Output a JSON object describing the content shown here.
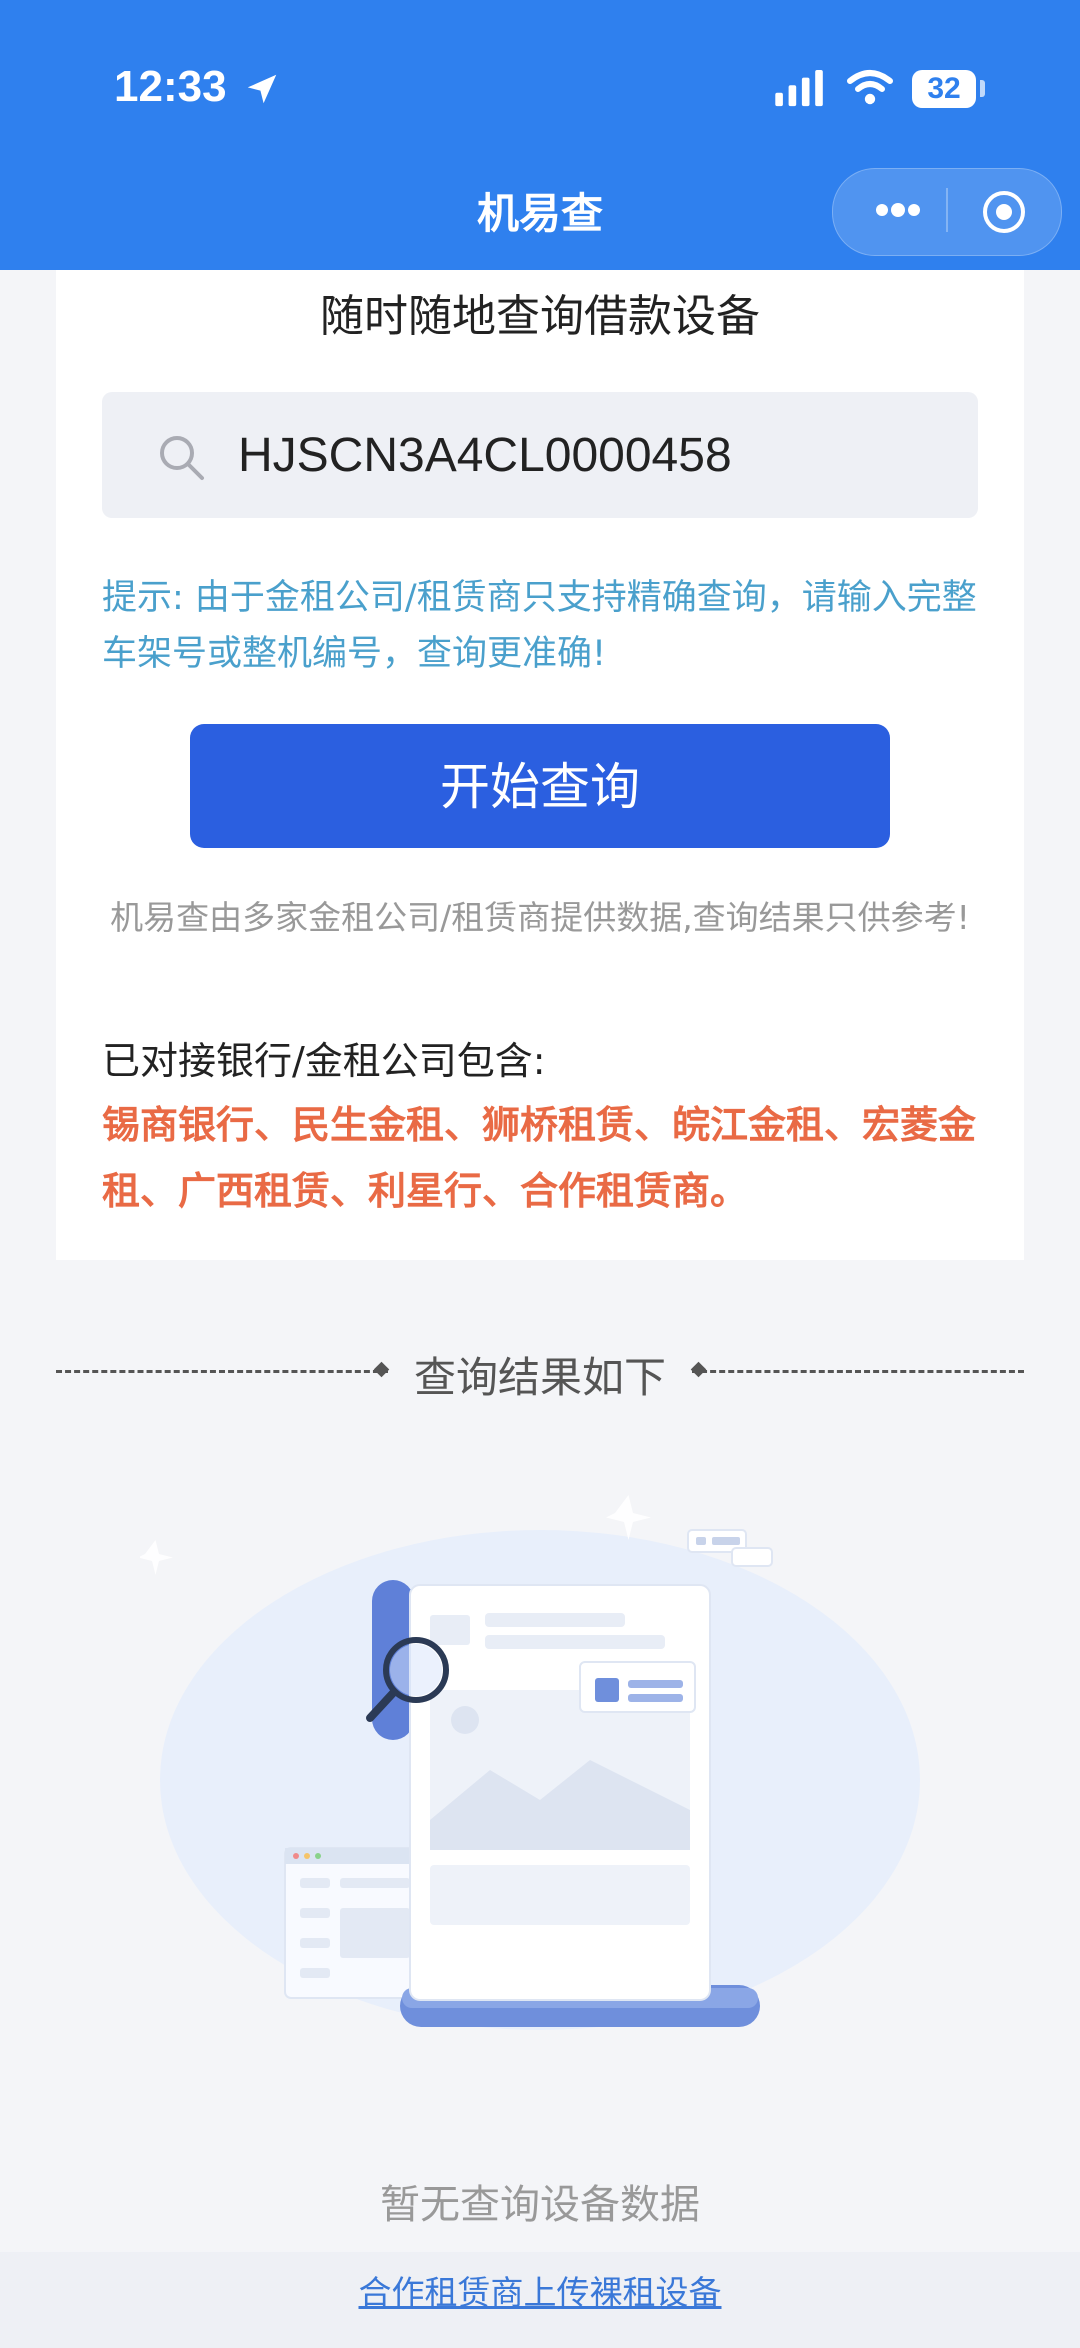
{
  "status_bar": {
    "time": "12:33",
    "battery": "32"
  },
  "nav": {
    "title": "机易查"
  },
  "card": {
    "title": "随时随地查询借款设备",
    "search": {
      "value": "HJSCN3A4CL0000458",
      "placeholder": ""
    },
    "tip": "提示: 由于金租公司/租赁商只支持精确查询，请输入完整车架号或整机编号，查询更准确!",
    "start_button": "开始查询",
    "disclaimer": "机易查由多家金租公司/租赁商提供数据,查询结果只供参考!",
    "partner_label": "已对接银行/金租公司包含:",
    "partners": "锡商银行、民生金租、狮桥租赁、皖江金租、宏菱金租、广西租赁、利星行、合作租赁商。"
  },
  "results": {
    "title": "查询结果如下",
    "empty_text": "暂无查询设备数据"
  },
  "footer": {
    "link": "合作租赁商上传裸租设备"
  },
  "colors": {
    "header": "#2f80ee",
    "primary_button": "#2b5fe0",
    "tip": "#4aa0cc",
    "partners": "#e96a45",
    "link": "#3a78d8"
  },
  "icons": {
    "location": "location-arrow-icon",
    "signal": "cellular-signal-icon",
    "wifi": "wifi-icon",
    "more": "more-dots-icon",
    "close": "miniprogram-close-icon",
    "search": "search-icon"
  }
}
